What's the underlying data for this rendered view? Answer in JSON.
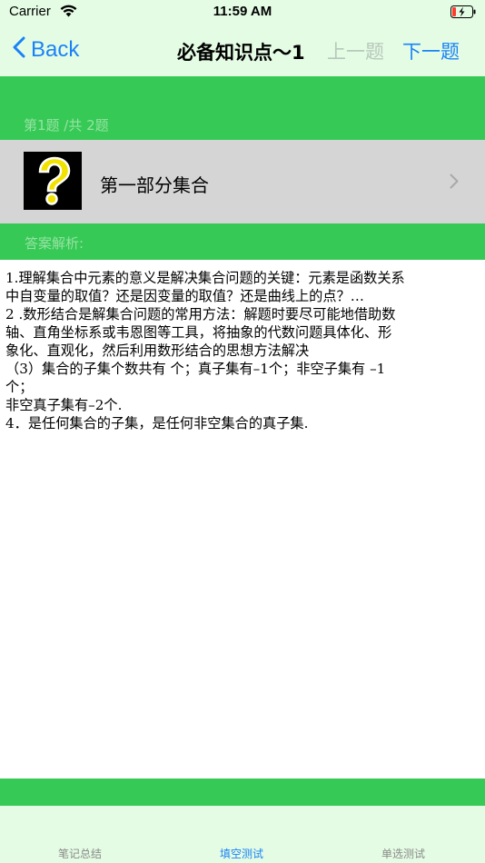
{
  "status_bar": {
    "carrier": "Carrier",
    "time": "11:59 AM"
  },
  "nav": {
    "back_label": "Back",
    "title": "必备知识点～1",
    "prev_label": "上一题",
    "next_label": "下一题"
  },
  "question": {
    "counter": "第1题 /共 2题",
    "title": "第一部分集合",
    "icon": "question-mark-icon"
  },
  "answer": {
    "label": "答案解析:",
    "lines": [
      "1.理解集合中元素的意义是解决集合问题的关键：元素是函数关系",
      "中自变量的取值？还是因变量的取值？还是曲线上的点？…",
      "2 .数形结合是解集合问题的常用方法：解题时要尽可能地借助数",
      "轴、直角坐标系或韦恩图等工具，将抽象的代数问题具体化、形",
      "象化、直观化，然后利用数形结合的思想方法解决",
      "（3）集合的子集个数共有 个；真子集有–1个；非空子集有 –1",
      "个；",
      "非空真子集有–2个.",
      "4．是任何集合的子集，是任何非空集合的真子集."
    ]
  },
  "tabs": [
    {
      "label": "笔记总结",
      "active": false
    },
    {
      "label": "填空测试",
      "active": true
    },
    {
      "label": "单选测试",
      "active": false
    }
  ],
  "colors": {
    "accent": "#1a82f7",
    "green": "#36c956",
    "light_green": "#e4fce4",
    "cell_gray": "#d5d5d5",
    "muted_green_text": "#96e3a2"
  }
}
